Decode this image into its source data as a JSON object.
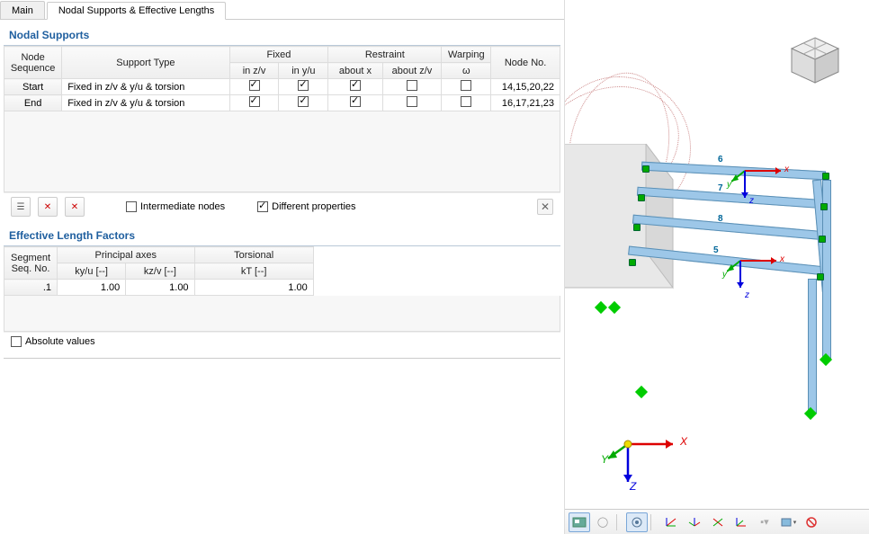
{
  "tabs": {
    "main": "Main",
    "nodal": "Nodal Supports & Effective Lengths"
  },
  "sections": {
    "nodal_supports": "Nodal Supports",
    "elf": "Effective Length Factors"
  },
  "th": {
    "node_seq": "Node Sequence",
    "support_type": "Support Type",
    "fixed": "Fixed",
    "in_zv": "in z/v",
    "in_yu": "in y/u",
    "restraint": "Restraint",
    "about_x": "about x",
    "about_zv": "about z/v",
    "warping": "Warping",
    "omega": "ω",
    "node_no": "Node No.",
    "seg_seq": "Segment Seq. No.",
    "principal": "Principal axes",
    "torsional": "Torsional",
    "kyu": "ky/u [--]",
    "kzv": "kz/v [--]",
    "kt": "kT [--]"
  },
  "rows": {
    "start": {
      "seq": "Start",
      "type": "Fixed in z/v & y/u & torsion",
      "zv": true,
      "yu": true,
      "ax": true,
      "azv": false,
      "w": false,
      "nodes": "14,15,20,22"
    },
    "end": {
      "seq": "End",
      "type": "Fixed in z/v & y/u & torsion",
      "zv": true,
      "yu": true,
      "ax": true,
      "azv": false,
      "w": false,
      "nodes": "16,17,21,23"
    }
  },
  "opts": {
    "intermediate": "Intermediate nodes",
    "diff_props": "Different properties",
    "abs_vals": "Absolute values"
  },
  "elf_rows": [
    {
      "seq": ".1",
      "kyu": "1.00",
      "kzv": "1.00",
      "kt": "1.00"
    }
  ],
  "axis": {
    "x": "x",
    "y": "y",
    "z": "z",
    "X": "X",
    "Y": "Y",
    "Z": "Z"
  },
  "beams": [
    "5",
    "6",
    "7",
    "8"
  ]
}
